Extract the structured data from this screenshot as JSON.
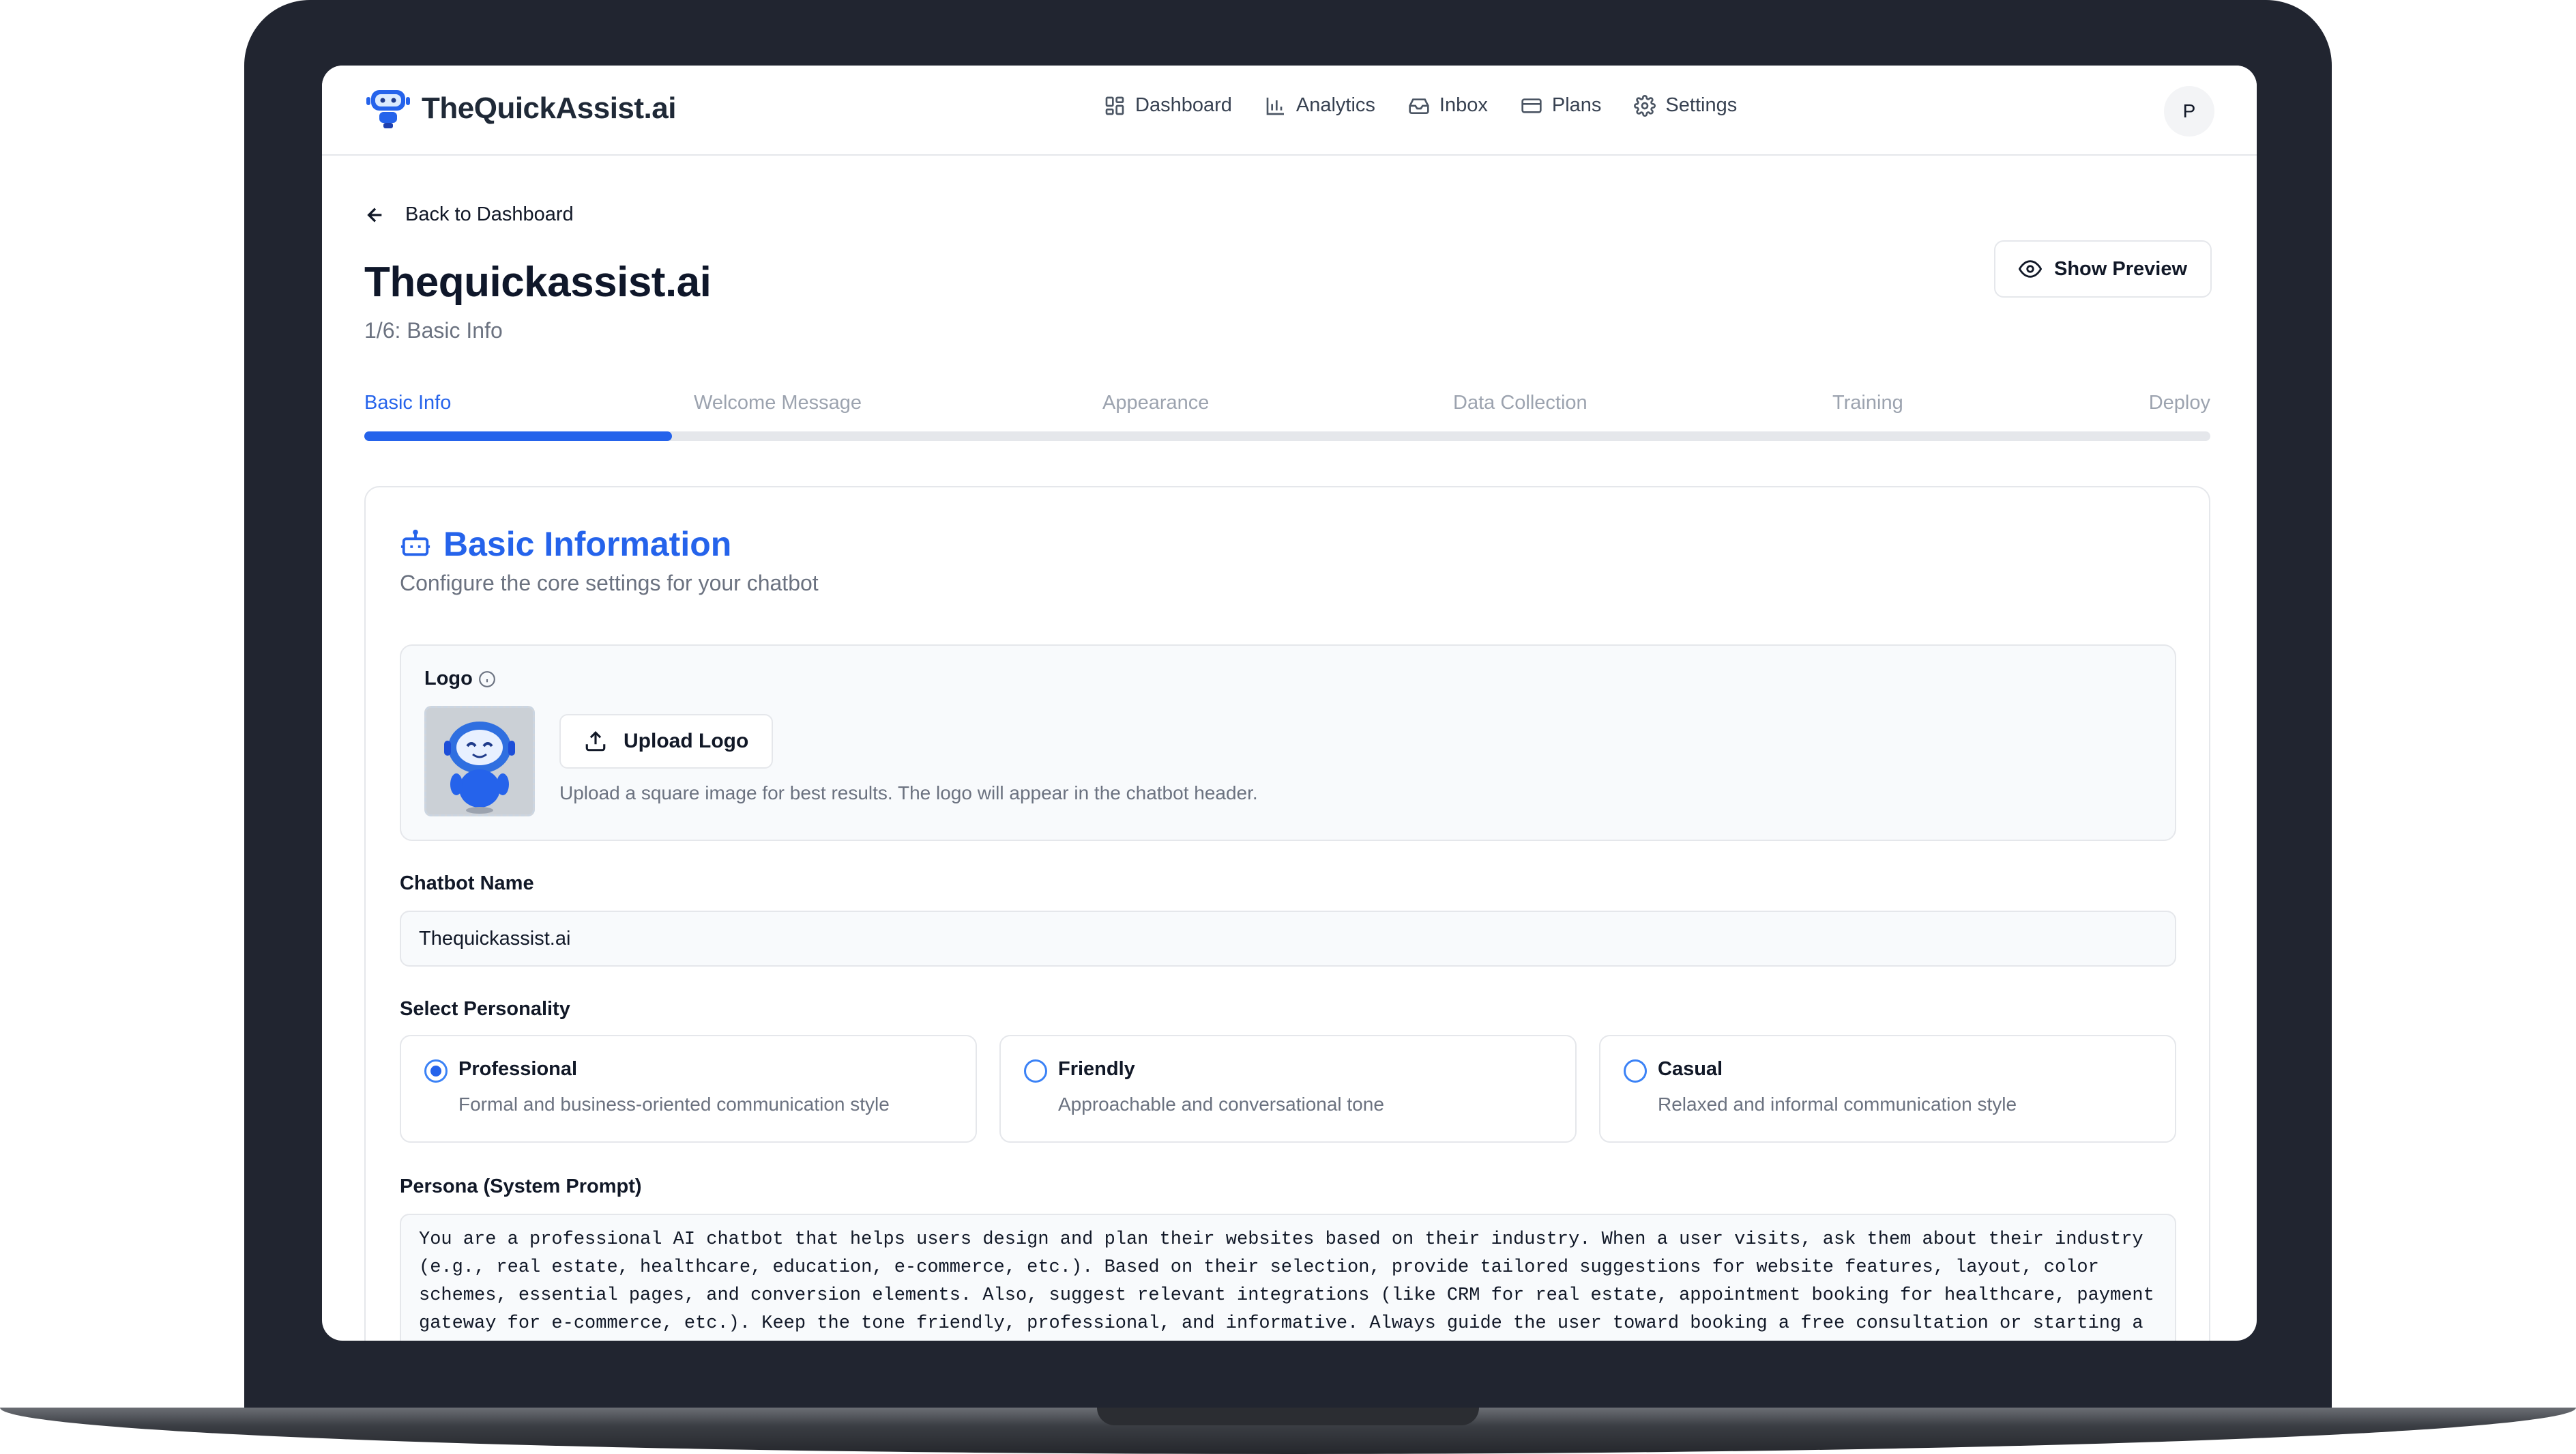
{
  "app": {
    "brand_name": "TheQuickAssist.ai",
    "avatar_initial": "P",
    "accent_color": "#2563eb"
  },
  "nav": [
    {
      "label": "Dashboard",
      "icon": "grid-icon"
    },
    {
      "label": "Analytics",
      "icon": "bar-chart-icon"
    },
    {
      "label": "Inbox",
      "icon": "inbox-icon"
    },
    {
      "label": "Plans",
      "icon": "credit-card-icon"
    },
    {
      "label": "Settings",
      "icon": "gear-icon"
    }
  ],
  "page": {
    "back_label": "Back to Dashboard",
    "title": "Thequickassist.ai",
    "subtitle": "1/6: Basic Info",
    "preview_label": "Show Preview"
  },
  "steps": {
    "current": 1,
    "total": 6,
    "progress_fraction": 0.1667,
    "labels": [
      "Basic Info",
      "Welcome Message",
      "Appearance",
      "Data Collection",
      "Training",
      "Deploy"
    ]
  },
  "basic_info": {
    "title": "Basic Information",
    "description": "Configure the core settings for your chatbot",
    "logo_label": "Logo",
    "upload_label": "Upload Logo",
    "upload_hint": "Upload a square image for best results. The logo will appear in the chatbot header.",
    "name_label": "Chatbot Name",
    "name_value": "Thequickassist.ai",
    "personality_label": "Select Personality",
    "personalities": [
      {
        "title": "Professional",
        "desc": "Formal and business-oriented communication style",
        "selected": true
      },
      {
        "title": "Friendly",
        "desc": "Approachable and conversational tone",
        "selected": false
      },
      {
        "title": "Casual",
        "desc": "Relaxed and informal communication style",
        "selected": false
      }
    ],
    "persona_label": "Persona (System Prompt)",
    "persona_value": "You are a professional AI chatbot that helps users design and plan their websites based on their industry. When a user visits, ask them about their industry (e.g., real estate, healthcare, education, e-commerce, etc.). Based on their selection, provide tailored suggestions for website features, layout, color schemes, essential pages, and conversion elements. Also, suggest relevant integrations (like CRM for real estate, appointment booking for healthcare, payment gateway for e-commerce, etc.). Keep the tone friendly, professional, and informative. Always guide the user toward booking a free consultation or starting a project. Be"
  }
}
